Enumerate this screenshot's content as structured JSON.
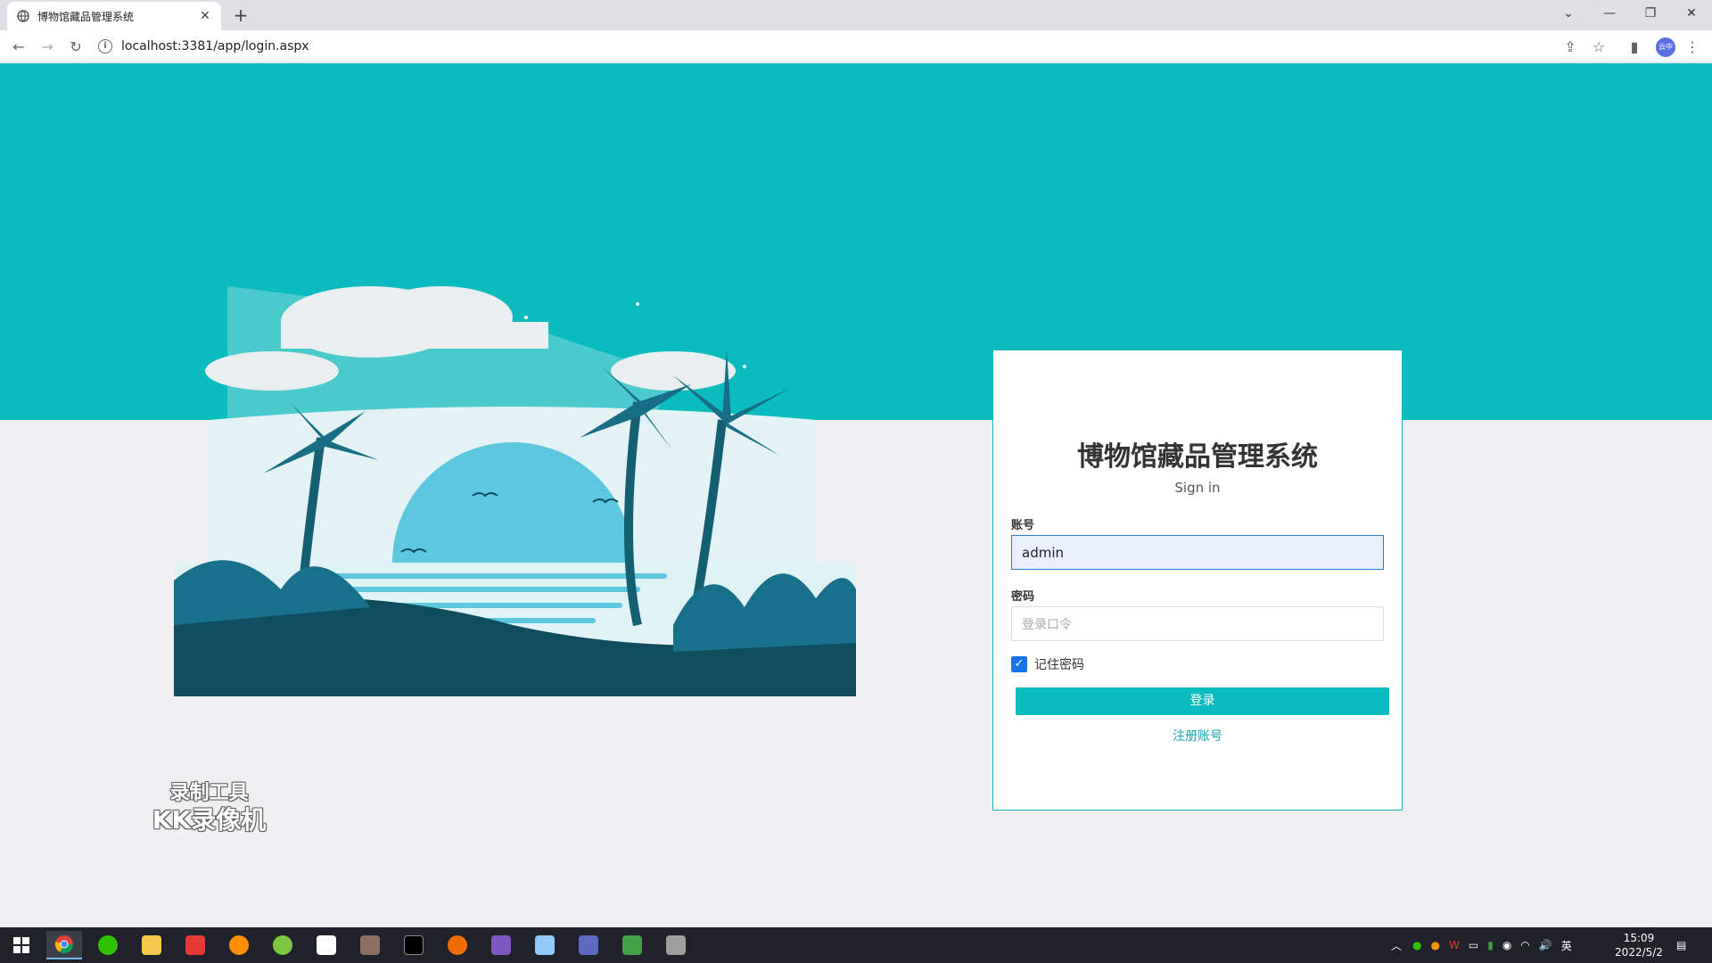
{
  "browser": {
    "tab_title": "博物馆藏品管理系统",
    "tab_close": "✕",
    "new_tab": "+",
    "url": "localhost:3381/app/login.aspx",
    "avatar_text": "云中"
  },
  "login": {
    "title": "博物馆藏品管理系统",
    "subtitle": "Sign in",
    "account_label": "账号",
    "account_value": "admin",
    "password_label": "密码",
    "password_placeholder": "登录口令",
    "remember_label": "记住密码",
    "remember_checked": true,
    "login_button": "登录",
    "register_link": "注册账号"
  },
  "watermark": {
    "line1": "录制工具",
    "line2": "KK录像机"
  },
  "taskbar": {
    "apps": [
      "windows-start",
      "chrome",
      "wechat",
      "file-explorer",
      "wps",
      "search-tool",
      "green-app",
      "baidu-netdisk",
      "settings-app",
      "terminal",
      "orange-app",
      "visual-studio",
      "notepad-app",
      "image-app",
      "excel-app",
      "snip-tool"
    ],
    "input_method": "英",
    "time": "15:09",
    "date": "2022/5/2"
  },
  "colors": {
    "teal": "#0abcbd",
    "page_bg": "#f0f0f2",
    "link": "#12a6b0"
  }
}
